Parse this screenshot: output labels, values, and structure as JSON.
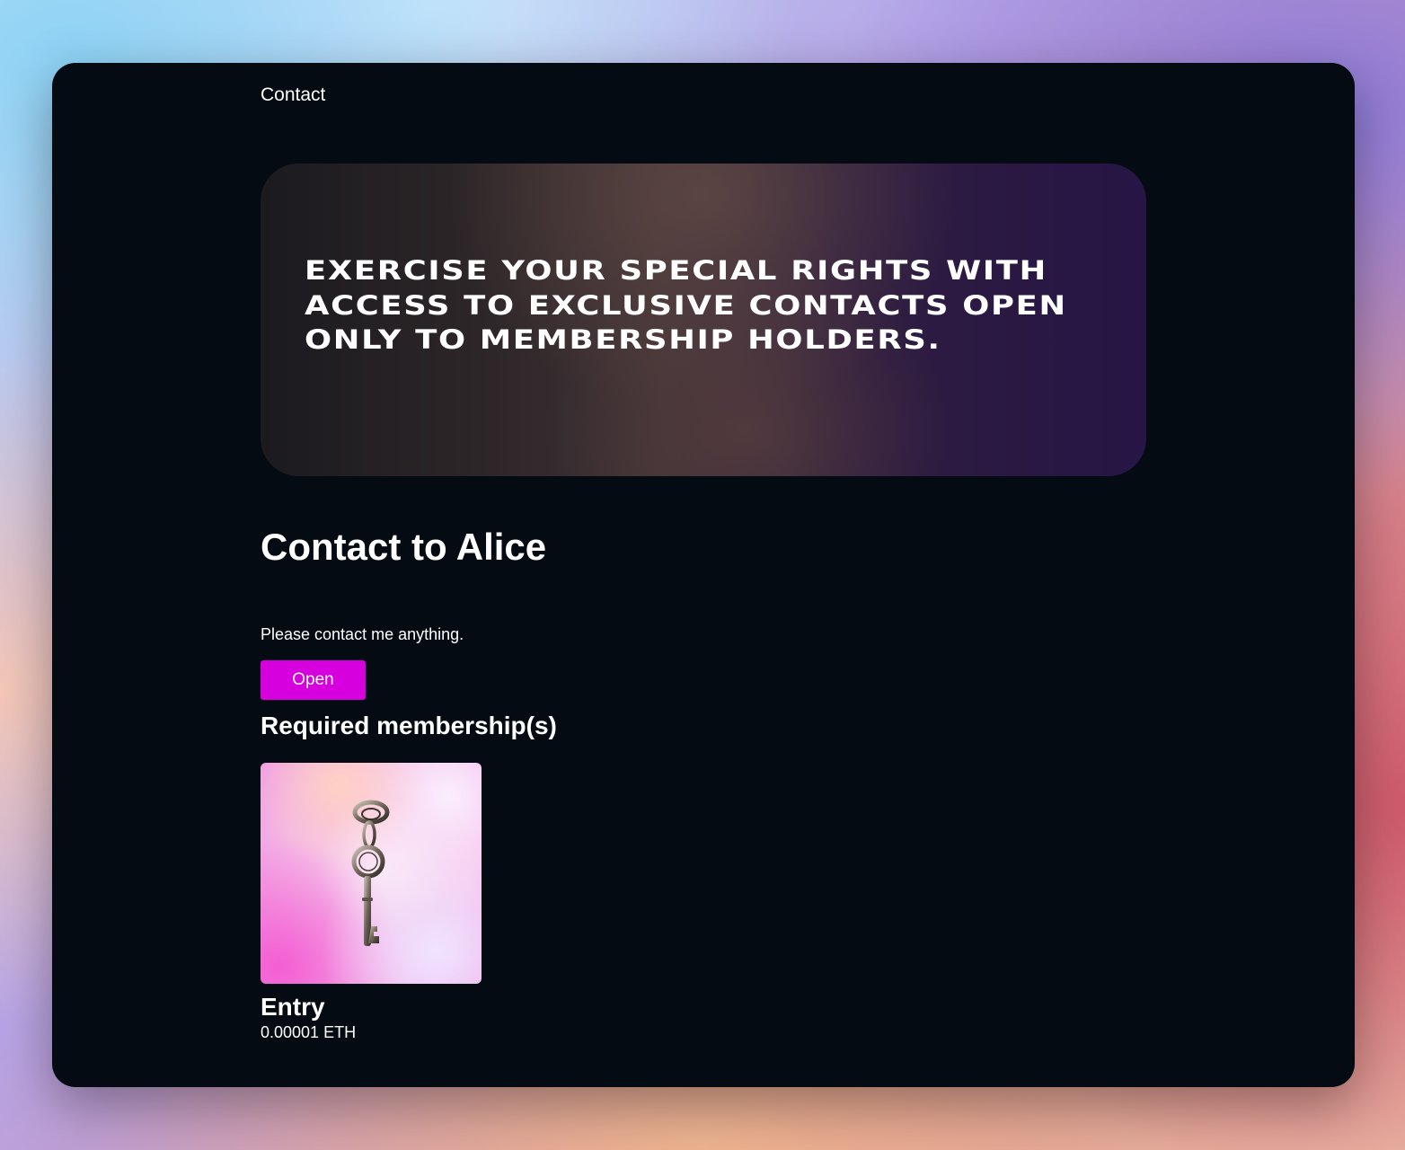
{
  "nav": {
    "contact_label": "Contact"
  },
  "hero": {
    "text": "Exercise your special rights with access to exclusive contacts open only to membership holders."
  },
  "contact": {
    "title": "Contact to Alice",
    "description": "Please contact me anything.",
    "open_button_label": "Open"
  },
  "memberships": {
    "section_title": "Required membership(s)",
    "items": [
      {
        "name": "Entry",
        "price": "0.00001 ETH",
        "image_icon": "key-icon"
      }
    ]
  },
  "colors": {
    "window_background": "#050b12",
    "accent_button": "#d500dd",
    "text": "#ffffff"
  }
}
